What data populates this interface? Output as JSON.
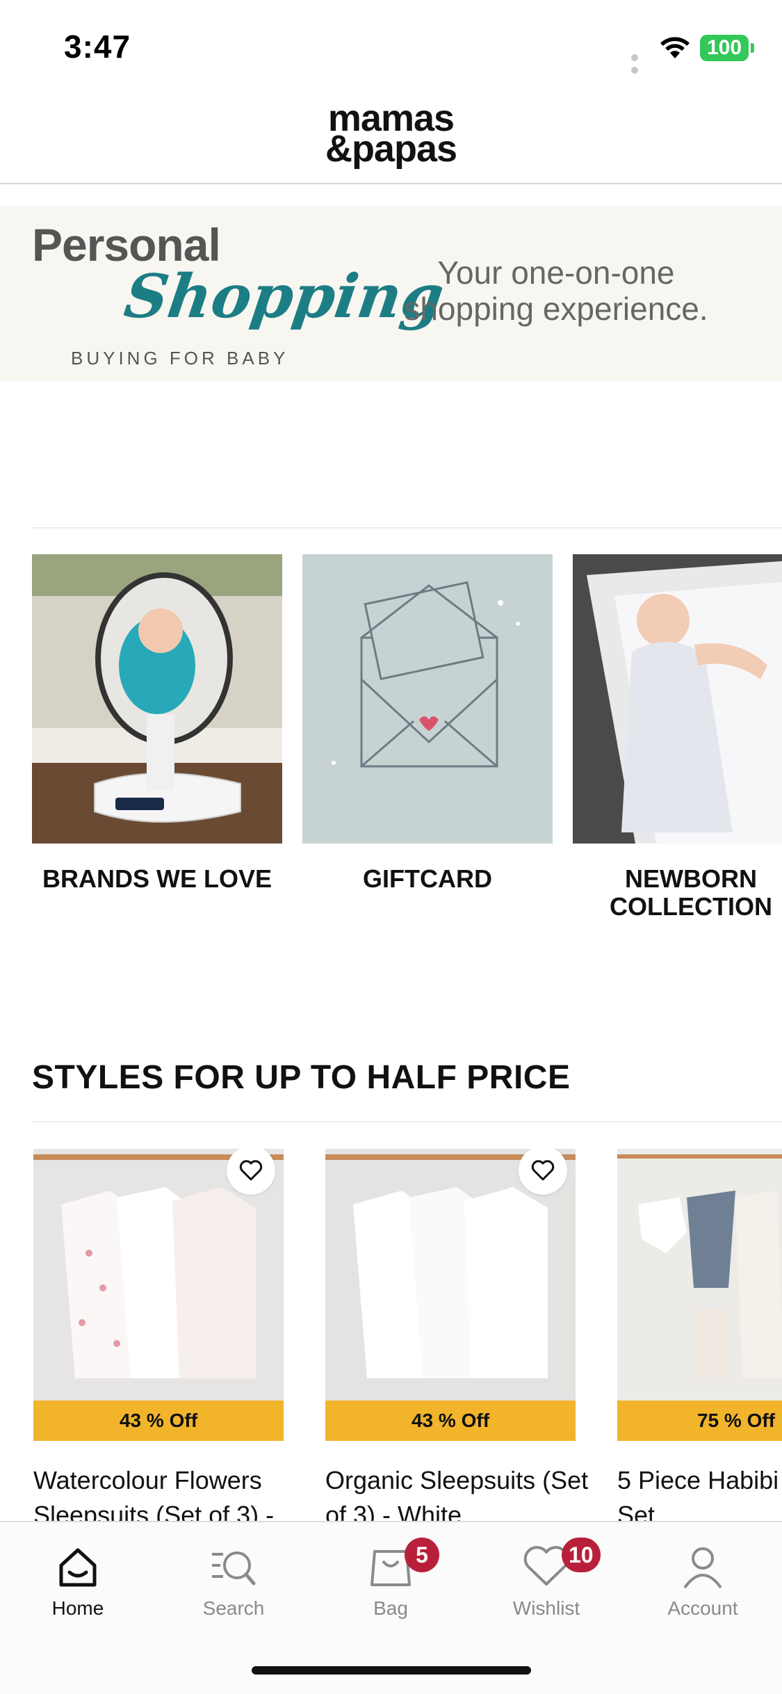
{
  "status_bar": {
    "time": "3:47",
    "battery": "100"
  },
  "brand": {
    "logo_line1": "mamas",
    "logo_line2": "&papas"
  },
  "banner": {
    "title_line1": "Personal",
    "title_line2": "Shopping",
    "subtitle": "BUYING FOR BABY",
    "tagline": "Your one-on-one shopping experience."
  },
  "categories": [
    {
      "label": "BRANDS WE LOVE"
    },
    {
      "label": "GIFTCARD"
    },
    {
      "label": "NEWBORN COLLECTION"
    }
  ],
  "sale_section": {
    "title": "STYLES FOR UP TO HALF PRICE",
    "products": [
      {
        "discount": "43 % Off",
        "name": "Watercolour Flowers Sleepsuits (Set of 3) -"
      },
      {
        "discount": "43 % Off",
        "name": "Organic Sleepsuits (Set of 3) - White"
      },
      {
        "discount": "75 % Off",
        "name": "5 Piece Habibi Set"
      }
    ]
  },
  "tabbar": {
    "tabs": [
      {
        "label": "Home"
      },
      {
        "label": "Search"
      },
      {
        "label": "Bag",
        "badge": "5"
      },
      {
        "label": "Wishlist",
        "badge": "10"
      },
      {
        "label": "Account"
      }
    ]
  },
  "colors": {
    "accent_teal": "#1c7d85",
    "discount_yellow": "#f1b42b",
    "badge_red": "#b8203a",
    "battery_green": "#34c759"
  }
}
